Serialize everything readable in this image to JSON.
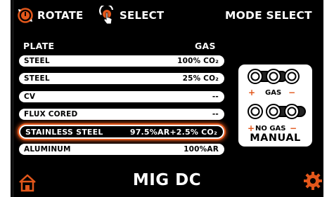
{
  "topbar": {
    "rotate_label": "ROTATE",
    "select_label": "SELECT",
    "mode_select_label": "MODE SELECT"
  },
  "table": {
    "col_plate": "PLATE",
    "col_gas": "GAS",
    "rows": [
      {
        "plate": "STEEL",
        "gas": "100% CO₂"
      },
      {
        "plate": "STEEL",
        "gas": "25% CO₂"
      },
      {
        "plate": "CV",
        "gas": "--"
      },
      {
        "plate": "FLUX CORED",
        "gas": "--"
      },
      {
        "plate": "STAINLESS STEEL",
        "gas": "97.5%AR+2.5% CO₂"
      },
      {
        "plate": "ALUMINUM",
        "gas": "100%AR"
      }
    ],
    "selected_index": 4
  },
  "polarity_panel": {
    "gas_label": "GAS",
    "no_gas_label": "NO GAS",
    "manual_label": "MANUAL",
    "plus_symbol": "+",
    "minus_symbol": "−"
  },
  "footer": {
    "mode_title": "MIG DC"
  },
  "icons": {
    "rotate": "rotate-knob-icon",
    "select": "press-knob-icon",
    "home": "home-icon",
    "settings": "gear-icon"
  },
  "colors": {
    "accent": "#e2571b",
    "background": "#000000",
    "row_fill": "#ffffff"
  }
}
